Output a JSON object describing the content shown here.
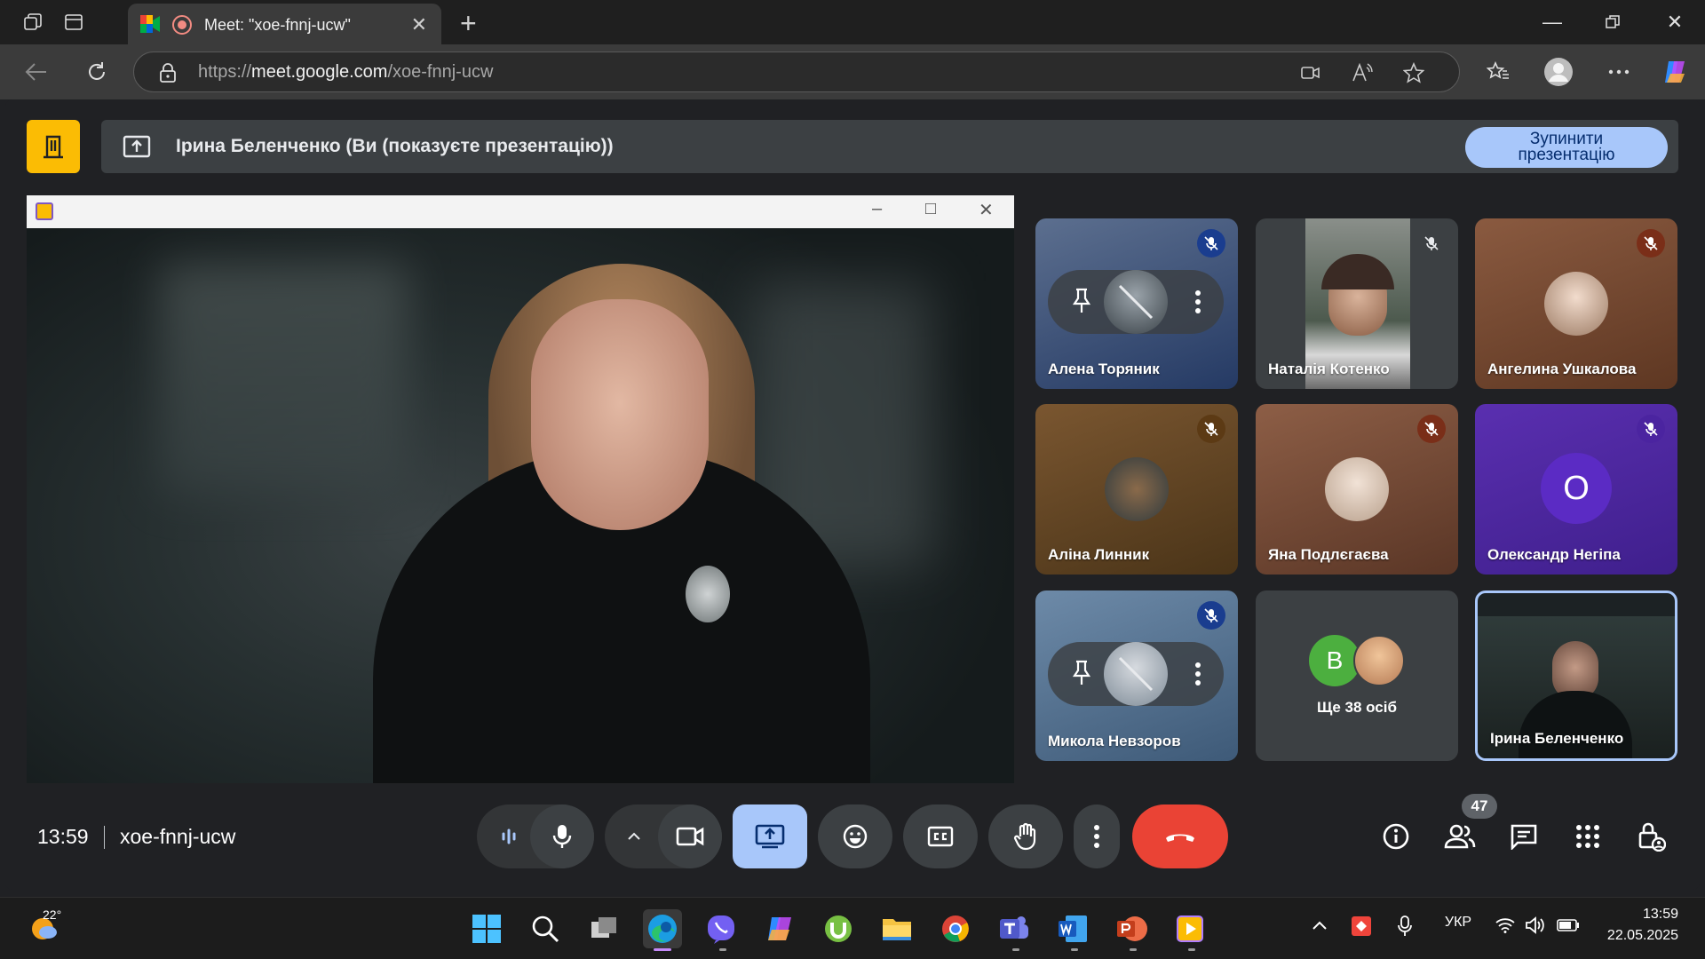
{
  "browser": {
    "tab_title": "Meet: \"xoe-fnnj-ucw\"",
    "url_prefix": "https://",
    "url_host": "meet.google.com",
    "url_path": "/xoe-fnnj-ucw"
  },
  "banner": {
    "text": "Ірина Беленченко (Ви (показуєте презентацію))",
    "stop_line1": "Зупинити",
    "stop_line2": "презентацію"
  },
  "participants": [
    {
      "name": "Алена Торяник",
      "muted": true,
      "hover": true
    },
    {
      "name": "Наталія Котенко",
      "muted": true
    },
    {
      "name": "Ангелина Ушкалова",
      "muted": true
    },
    {
      "name": "Аліна Линник",
      "muted": true
    },
    {
      "name": "Яна Подлєгаєва",
      "muted": true
    },
    {
      "name": "Олександр Негіпа",
      "initial": "О",
      "muted": true
    },
    {
      "name": "Микола Невзоров",
      "muted": true,
      "hover": true
    },
    {
      "name": "Ірина Беленченко",
      "self": true
    }
  ],
  "more_tile": {
    "label": "Ще 38 осіб",
    "initial": "B"
  },
  "footer": {
    "time": "13:59",
    "meeting_code": "xoe-fnnj-ucw",
    "people_count": "47"
  },
  "taskbar": {
    "temperature": "22°",
    "language": "УКР",
    "time": "13:59",
    "date": "22.05.2025"
  },
  "colors": {
    "accent": "#a8c7fa",
    "end_call": "#ea4335",
    "door": "#fbbc04"
  }
}
